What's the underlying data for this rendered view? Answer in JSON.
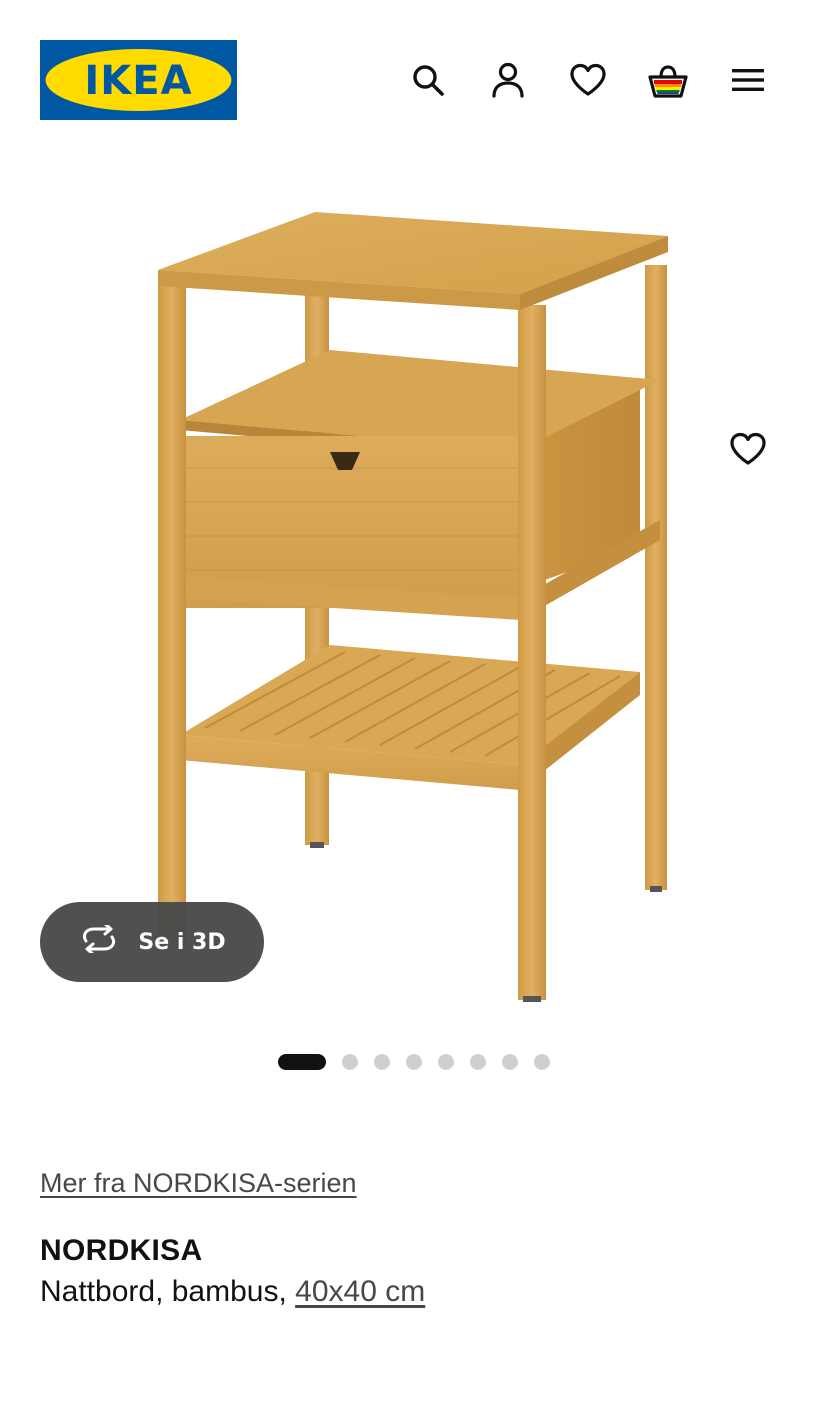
{
  "header": {
    "logo_text": "IKEA",
    "icons": [
      "search-icon",
      "account-icon",
      "heart-icon",
      "shopping-bag-icon",
      "menu-icon"
    ]
  },
  "gallery": {
    "view_3d_label": "Se i 3D",
    "image_count": 8,
    "active_index": 0
  },
  "product": {
    "series_link": "Mer fra NORDKISA-serien",
    "name": "NORDKISA",
    "description": "Nattbord, bambus, ",
    "size": "40x40 cm"
  },
  "colors": {
    "ikea_blue": "#0058a3",
    "ikea_yellow": "#ffdb00",
    "wood": "#d9a64e",
    "dark": "#111111"
  }
}
